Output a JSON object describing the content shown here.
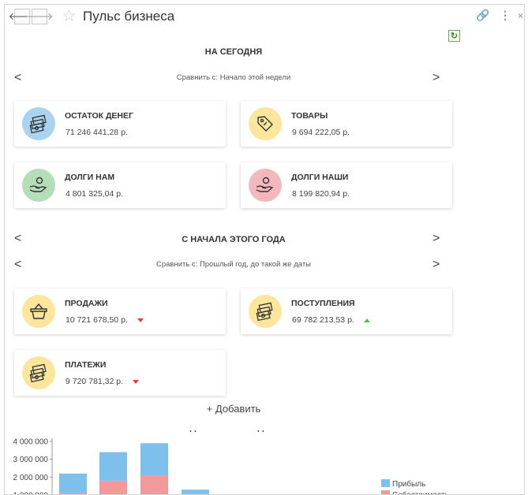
{
  "window": {
    "title": "Пульс бизнеса",
    "back_symbol": "🡐",
    "forward_symbol": "🡒",
    "star_symbol": "☆",
    "link_symbol": "🔗",
    "more_symbol": "⋮",
    "close_symbol": "×",
    "refresh_symbol": "↻"
  },
  "today": {
    "heading": "НА СЕГОДНЯ",
    "compare": "Сравнить с: Начало этой недели",
    "cards": [
      {
        "label": "ОСТАТОК ДЕНЕГ",
        "value": "71 246 441,28 р.",
        "icon": "cash-icon",
        "color": "#a9d3ef"
      },
      {
        "label": "ТОВАРЫ",
        "value": "9 694 222,05 р.",
        "icon": "tag-icon",
        "color": "#fbe69b"
      },
      {
        "label": "ДОЛГИ НАМ",
        "value": "4 801 325,04 р.",
        "icon": "hand-coin-icon",
        "color": "#b5ddb8"
      },
      {
        "label": "ДОЛГИ НАШИ",
        "value": "8 199 820,94 р.",
        "icon": "hand-coin-icon",
        "color": "#f3b8bd"
      }
    ]
  },
  "year": {
    "heading": "С НАЧАЛА ЭТОГО ГОДА",
    "compare": "Сравнить с: Прошлый год, до такой же даты",
    "cards": [
      {
        "label": "ПРОДАЖИ",
        "value": "10 721 678,50 р.",
        "icon": "basket-icon",
        "color": "#fbe69b",
        "trend": "down"
      },
      {
        "label": "ПОСТУПЛЕНИЯ",
        "value": "69 782 213,53 р.",
        "icon": "cash-icon",
        "color": "#fbe69b",
        "trend": "up"
      },
      {
        "label": "ПЛАТЕЖИ",
        "value": "9 720 781,32 р.",
        "icon": "cash-icon",
        "color": "#fbe69b",
        "trend": "down"
      }
    ]
  },
  "nav": {
    "left": "<",
    "right": ">"
  },
  "add_label": "+ Добавить",
  "chart_data": {
    "type": "bar",
    "title": "ДИНАМИКА ПРОДАЖ",
    "y_ticks": [
      "4 000 000",
      "3 000 000",
      "2 000 000",
      "1 000 000"
    ],
    "ylim": [
      0,
      4000000
    ],
    "categories": [
      "",
      "",
      "",
      ""
    ],
    "series": [
      {
        "name": "Себестоимость",
        "color": "#f2999b",
        "values": [
          1100000,
          1800000,
          2100000,
          0
        ]
      },
      {
        "name": "Прибыль",
        "color": "#7cc0eb",
        "values": [
          1100000,
          1600000,
          1800000,
          1300000
        ]
      }
    ],
    "legend": "right",
    "stacked": true
  }
}
